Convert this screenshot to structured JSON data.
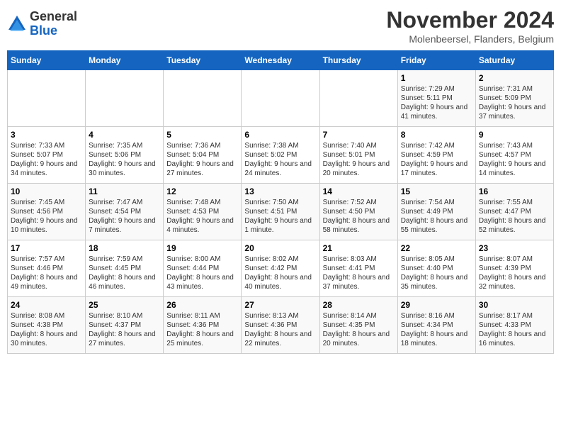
{
  "logo": {
    "general": "General",
    "blue": "Blue"
  },
  "title": "November 2024",
  "location": "Molenbeersel, Flanders, Belgium",
  "days_of_week": [
    "Sunday",
    "Monday",
    "Tuesday",
    "Wednesday",
    "Thursday",
    "Friday",
    "Saturday"
  ],
  "weeks": [
    [
      {
        "day": "",
        "info": ""
      },
      {
        "day": "",
        "info": ""
      },
      {
        "day": "",
        "info": ""
      },
      {
        "day": "",
        "info": ""
      },
      {
        "day": "",
        "info": ""
      },
      {
        "day": "1",
        "info": "Sunrise: 7:29 AM\nSunset: 5:11 PM\nDaylight: 9 hours and 41 minutes."
      },
      {
        "day": "2",
        "info": "Sunrise: 7:31 AM\nSunset: 5:09 PM\nDaylight: 9 hours and 37 minutes."
      }
    ],
    [
      {
        "day": "3",
        "info": "Sunrise: 7:33 AM\nSunset: 5:07 PM\nDaylight: 9 hours and 34 minutes."
      },
      {
        "day": "4",
        "info": "Sunrise: 7:35 AM\nSunset: 5:06 PM\nDaylight: 9 hours and 30 minutes."
      },
      {
        "day": "5",
        "info": "Sunrise: 7:36 AM\nSunset: 5:04 PM\nDaylight: 9 hours and 27 minutes."
      },
      {
        "day": "6",
        "info": "Sunrise: 7:38 AM\nSunset: 5:02 PM\nDaylight: 9 hours and 24 minutes."
      },
      {
        "day": "7",
        "info": "Sunrise: 7:40 AM\nSunset: 5:01 PM\nDaylight: 9 hours and 20 minutes."
      },
      {
        "day": "8",
        "info": "Sunrise: 7:42 AM\nSunset: 4:59 PM\nDaylight: 9 hours and 17 minutes."
      },
      {
        "day": "9",
        "info": "Sunrise: 7:43 AM\nSunset: 4:57 PM\nDaylight: 9 hours and 14 minutes."
      }
    ],
    [
      {
        "day": "10",
        "info": "Sunrise: 7:45 AM\nSunset: 4:56 PM\nDaylight: 9 hours and 10 minutes."
      },
      {
        "day": "11",
        "info": "Sunrise: 7:47 AM\nSunset: 4:54 PM\nDaylight: 9 hours and 7 minutes."
      },
      {
        "day": "12",
        "info": "Sunrise: 7:48 AM\nSunset: 4:53 PM\nDaylight: 9 hours and 4 minutes."
      },
      {
        "day": "13",
        "info": "Sunrise: 7:50 AM\nSunset: 4:51 PM\nDaylight: 9 hours and 1 minute."
      },
      {
        "day": "14",
        "info": "Sunrise: 7:52 AM\nSunset: 4:50 PM\nDaylight: 8 hours and 58 minutes."
      },
      {
        "day": "15",
        "info": "Sunrise: 7:54 AM\nSunset: 4:49 PM\nDaylight: 8 hours and 55 minutes."
      },
      {
        "day": "16",
        "info": "Sunrise: 7:55 AM\nSunset: 4:47 PM\nDaylight: 8 hours and 52 minutes."
      }
    ],
    [
      {
        "day": "17",
        "info": "Sunrise: 7:57 AM\nSunset: 4:46 PM\nDaylight: 8 hours and 49 minutes."
      },
      {
        "day": "18",
        "info": "Sunrise: 7:59 AM\nSunset: 4:45 PM\nDaylight: 8 hours and 46 minutes."
      },
      {
        "day": "19",
        "info": "Sunrise: 8:00 AM\nSunset: 4:44 PM\nDaylight: 8 hours and 43 minutes."
      },
      {
        "day": "20",
        "info": "Sunrise: 8:02 AM\nSunset: 4:42 PM\nDaylight: 8 hours and 40 minutes."
      },
      {
        "day": "21",
        "info": "Sunrise: 8:03 AM\nSunset: 4:41 PM\nDaylight: 8 hours and 37 minutes."
      },
      {
        "day": "22",
        "info": "Sunrise: 8:05 AM\nSunset: 4:40 PM\nDaylight: 8 hours and 35 minutes."
      },
      {
        "day": "23",
        "info": "Sunrise: 8:07 AM\nSunset: 4:39 PM\nDaylight: 8 hours and 32 minutes."
      }
    ],
    [
      {
        "day": "24",
        "info": "Sunrise: 8:08 AM\nSunset: 4:38 PM\nDaylight: 8 hours and 30 minutes."
      },
      {
        "day": "25",
        "info": "Sunrise: 8:10 AM\nSunset: 4:37 PM\nDaylight: 8 hours and 27 minutes."
      },
      {
        "day": "26",
        "info": "Sunrise: 8:11 AM\nSunset: 4:36 PM\nDaylight: 8 hours and 25 minutes."
      },
      {
        "day": "27",
        "info": "Sunrise: 8:13 AM\nSunset: 4:36 PM\nDaylight: 8 hours and 22 minutes."
      },
      {
        "day": "28",
        "info": "Sunrise: 8:14 AM\nSunset: 4:35 PM\nDaylight: 8 hours and 20 minutes."
      },
      {
        "day": "29",
        "info": "Sunrise: 8:16 AM\nSunset: 4:34 PM\nDaylight: 8 hours and 18 minutes."
      },
      {
        "day": "30",
        "info": "Sunrise: 8:17 AM\nSunset: 4:33 PM\nDaylight: 8 hours and 16 minutes."
      }
    ]
  ]
}
